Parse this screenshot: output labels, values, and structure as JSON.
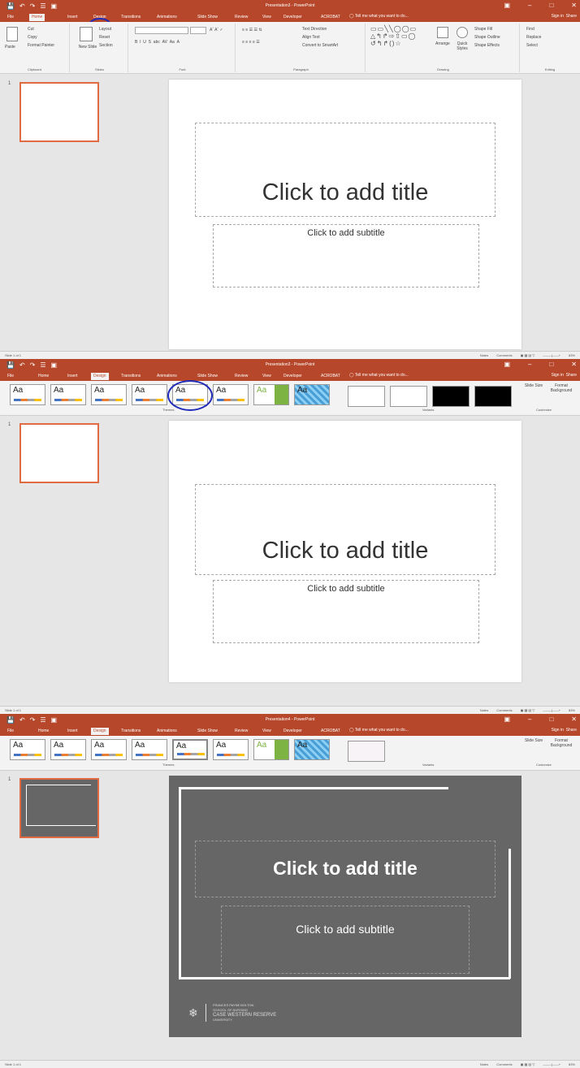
{
  "app": {
    "title_s1": "Presentation3 - PowerPoint",
    "title_s2": "Presentation3 - PowerPoint",
    "title_s3": "Presentation4 - PowerPoint",
    "qat": [
      "💾",
      "↶",
      "↷",
      "☰",
      "▣"
    ],
    "win_controls": [
      "▣",
      "–",
      "□",
      "✕"
    ],
    "tell_me": "Tell me what you want to do...",
    "sign_in": "Sign in",
    "share": "Share"
  },
  "tabs": [
    "File",
    "Home",
    "Insert",
    "Design",
    "Transitions",
    "Animations",
    "Slide Show",
    "Review",
    "View",
    "Developer",
    "ACROBAT"
  ],
  "home_ribbon": {
    "clipboard": {
      "paste": "Paste",
      "cut": "Cut",
      "copy": "Copy",
      "format_painter": "Format Painter",
      "label": "Clipboard"
    },
    "slides": {
      "new_slide": "New Slide",
      "layout": "Layout",
      "reset": "Reset",
      "section": "Section",
      "label": "Slides"
    },
    "font": {
      "label": "Font"
    },
    "paragraph": {
      "text_direction": "Text Direction",
      "align_text": "Align Text",
      "smartart": "Convert to SmartArt",
      "label": "Paragraph"
    },
    "drawing": {
      "arrange": "Arrange",
      "quick_styles": "Quick Styles",
      "shape_fill": "Shape Fill",
      "shape_outline": "Shape Outline",
      "shape_effects": "Shape Effects",
      "label": "Drawing"
    },
    "editing": {
      "find": "Find",
      "replace": "Replace",
      "select": "Select",
      "label": "Editing"
    }
  },
  "design_ribbon": {
    "themes_label": "Themes",
    "variants_label": "Variants",
    "customize_label": "Customize",
    "slide_size": "Slide Size",
    "format_background": "Format Background",
    "theme_aa": "Aa"
  },
  "slide": {
    "number": "1",
    "title_placeholder": "Click to add title",
    "subtitle_placeholder": "Click to add subtitle"
  },
  "logo": {
    "line1": "FRANCES PAYNE BOLTON",
    "line2": "SCHOOL OF NURSING",
    "line3": "CASE WESTERN RESERVE",
    "line4": "UNIVERSITY"
  },
  "status": {
    "slide_of": "Slide 1 of 1",
    "notes": "Notes",
    "comments": "Comments",
    "zoom": "83%"
  },
  "colors": {
    "accent": "#b7472a",
    "highlight": "#1f2ab8",
    "thumb_border": "#e06a44",
    "dark_slide": "#666666"
  }
}
